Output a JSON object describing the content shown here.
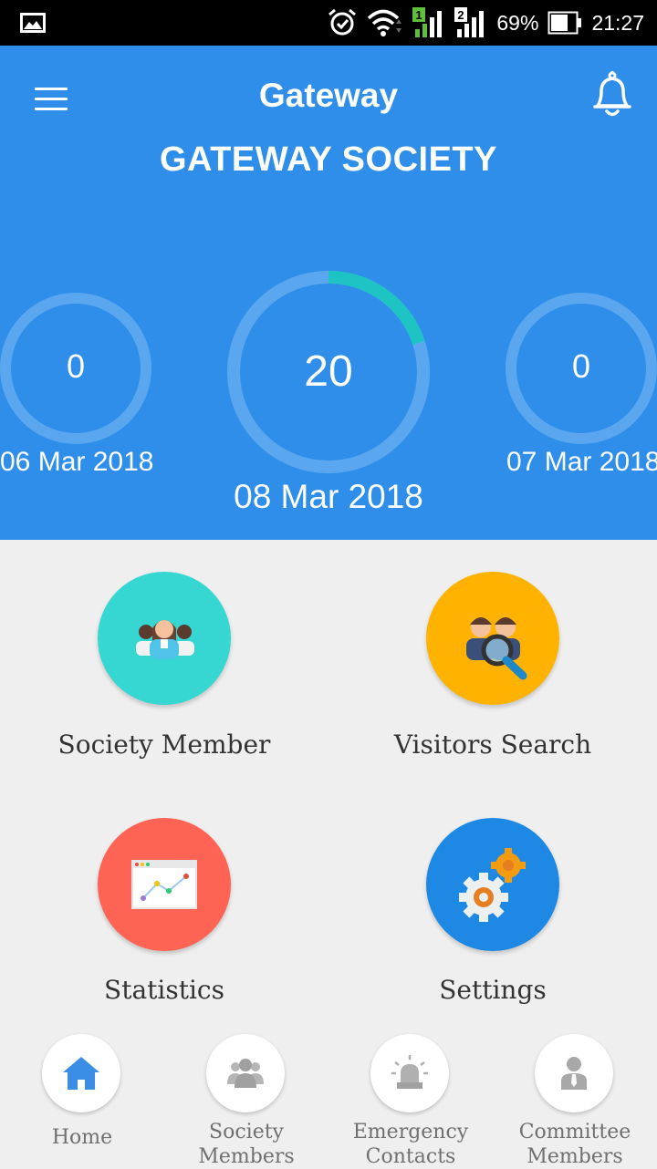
{
  "status_bar": {
    "battery": "69%",
    "time": "21:27",
    "sim1": "1",
    "sim2": "2"
  },
  "header": {
    "app_title": "Gateway",
    "society_name": "GATEWAY SOCIETY",
    "background_color": "#2e8eea"
  },
  "visitor_gauges": {
    "previous": {
      "value": "0",
      "date": "06 Mar 2018",
      "progress": 0
    },
    "current": {
      "value": "20",
      "date": "08 Mar 2018",
      "progress": 0.2
    },
    "next": {
      "value": "0",
      "date": "07 Mar 2018",
      "progress": 0
    }
  },
  "menu_tiles": [
    {
      "label": "Society Member",
      "color": "#36d7d2",
      "icon": "group-icon"
    },
    {
      "label": "Visitors Search",
      "color": "#ffb300",
      "icon": "people-search-icon"
    },
    {
      "label": "Statistics",
      "color": "#ff6353",
      "icon": "chart-icon"
    },
    {
      "label": "Settings",
      "color": "#1e88e5",
      "icon": "gears-icon"
    }
  ],
  "bottom_nav": [
    {
      "label": "Home",
      "icon": "home-icon",
      "active": true
    },
    {
      "label": "Society Members",
      "icon": "people-icon",
      "active": false
    },
    {
      "label": "Emergency Contacts",
      "icon": "siren-icon",
      "active": false
    },
    {
      "label": "Committee Members",
      "icon": "person-tie-icon",
      "active": false
    }
  ]
}
